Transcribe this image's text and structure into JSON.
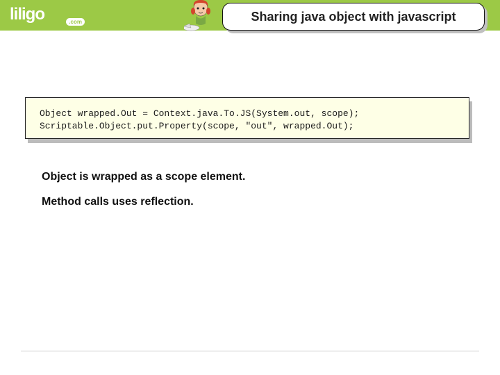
{
  "header": {
    "logo_text": "liligo",
    "logo_badge": ".com",
    "slide_title": "Sharing java object with javascript"
  },
  "code": {
    "line1": "Object wrapped.Out = Context.java.To.JS(System.out, scope);",
    "line2": "Scriptable.Object.put.Property(scope, \"out\", wrapped.Out);"
  },
  "body": {
    "para1": "Object is wrapped as a scope element.",
    "para2": "Method calls uses reflection."
  }
}
